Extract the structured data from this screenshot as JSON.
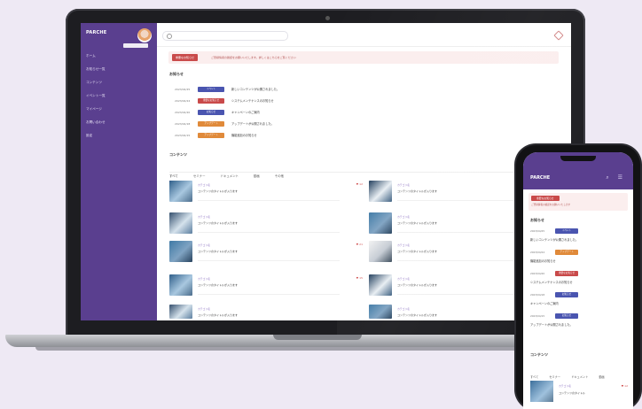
{
  "app": {
    "brand": "PARCHE",
    "sidebar_badge": ""
  },
  "colors": {
    "brand_purple": "#5a3f8f",
    "alert_red": "#c94a4a",
    "tag_blue": "#4a55b0",
    "tag_red": "#c94a4a",
    "tag_orange": "#e08a3a"
  },
  "sidebar": {
    "items": [
      {
        "label": "ホーム"
      },
      {
        "label": "お知らせ一覧"
      },
      {
        "label": "コンテンツ"
      },
      {
        "label": "イベント一覧"
      },
      {
        "label": "マイページ"
      },
      {
        "label": "お問い合わせ"
      },
      {
        "label": "設定"
      }
    ]
  },
  "alert": {
    "button": "重要なお知らせ",
    "text": "ご登録情報の確認をお願いいたします。詳しくはこちらをご覧ください"
  },
  "notices": {
    "title": "お知らせ",
    "items": [
      {
        "date": "2023/04/25",
        "tag": "イベント",
        "tag_color": "#4a55b0",
        "text": "新しいコンテンツが公開されました。"
      },
      {
        "date": "2023/04/24",
        "tag": "重要なお知らせ",
        "tag_color": "#c94a4a",
        "text": "システムメンテナンスのお知らせ"
      },
      {
        "date": "2023/04/20",
        "tag": "お知らせ",
        "tag_color": "#4a55b0",
        "text": "キャンペーンのご案内"
      },
      {
        "date": "2023/04/18",
        "tag": "アップデート",
        "tag_color": "#e08a3a",
        "text": "アップデートが公開されました。"
      },
      {
        "date": "2023/04/15",
        "tag": "アップデート",
        "tag_color": "#e08a3a",
        "text": "機能追加のお知らせ"
      }
    ]
  },
  "contents": {
    "title": "コンテンツ",
    "tabs": [
      "すべて",
      "セミナー",
      "ドキュメント",
      "動画",
      "その他"
    ],
    "cards": [
      {
        "meta": "カテゴリ名",
        "title": "コンテンツのタイトルが入ります",
        "like": "♥ 12",
        "color_a": "#2f5f8a",
        "color_b": "#a9c8e0"
      },
      {
        "meta": "カテゴリ名",
        "title": "コンテンツのタイトルが入ります",
        "like": "♥ 8",
        "color_a": "#35506e",
        "color_b": "#d5e2ec"
      },
      {
        "meta": "カテゴリ名",
        "title": "コンテンツのタイトルが入ります",
        "like": "♥ 21",
        "color_a": "#3f7aa6",
        "color_b": "#7fa3c2"
      },
      {
        "meta": "カテゴリ名",
        "title": "コンテンツのタイトルが入ります",
        "like": "♥ 5",
        "color_a": "#1f3c5b",
        "color_b": "#e8eef3"
      },
      {
        "meta": "カテゴリ名",
        "title": "コンテンツのタイトルが入ります",
        "like": "♥ 15",
        "color_a": "#2f5f8a",
        "color_b": "#a9c8e0"
      },
      {
        "meta": "カテゴリ名",
        "title": "コンテンツのタイトルが入ります",
        "like": "♥ 9",
        "color_a": "#35506e",
        "color_b": "#d5e2ec"
      },
      {
        "meta": "カテゴリ名",
        "title": "コンテンツのタイトルが入ります",
        "like": "♥ 3",
        "color_a": "#3f7aa6",
        "color_b": "#7fa3c2"
      },
      {
        "meta": "カテゴリ名",
        "title": "コンテンツのタイトルが入ります",
        "like": "♥ 11",
        "color_a": "#1f3c5b",
        "color_b": "#e8eef3"
      }
    ]
  },
  "phone": {
    "brand": "PARCHE",
    "icons": "⌕ ☰",
    "alert_button": "重要なお知らせ",
    "alert_text": "ご登録情報の確認をお願いいたします",
    "notices_title": "お知らせ",
    "items": [
      {
        "date": "2023/04/25",
        "tag": "イベント",
        "tag_color": "#4a55b0",
        "text": "新しいコンテンツが公開されました。"
      },
      {
        "date": "2023/04/24",
        "tag": "アップデート",
        "tag_color": "#e08a3a",
        "text": "機能追加のお知らせ"
      },
      {
        "date": "2023/04/20",
        "tag": "重要なお知らせ",
        "tag_color": "#c94a4a",
        "text": "システムメンテナンスのお知らせ"
      },
      {
        "date": "2023/04/18",
        "tag": "お知らせ",
        "tag_color": "#4a55b0",
        "text": "キャンペーンのご案内"
      },
      {
        "date": "2023/04/15",
        "tag": "お知らせ",
        "tag_color": "#4a55b0",
        "text": "アップデートが公開されました。"
      }
    ],
    "contents_title": "コンテンツ",
    "tabs": [
      "すべて",
      "セミナー",
      "ドキュメント",
      "動画"
    ],
    "card": {
      "meta": "カテゴリ名",
      "title": "コンテンツのタイトル",
      "like": "♥ 12"
    }
  }
}
